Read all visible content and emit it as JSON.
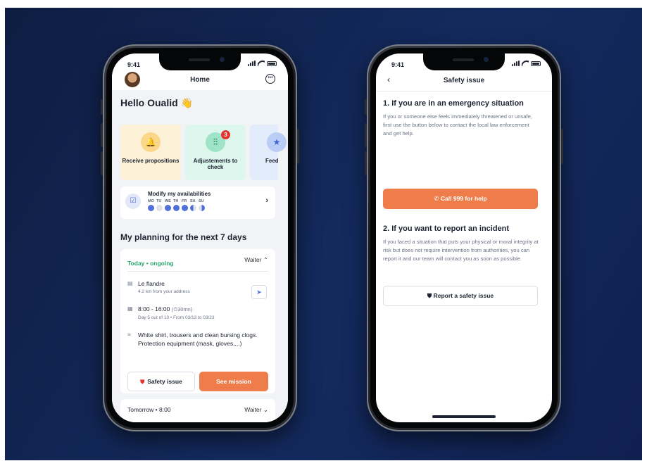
{
  "colors": {
    "background": "#0f2050",
    "accent": "#ef7d4b",
    "success": "#26a66b",
    "primary": "#4f6fd6",
    "danger": "#e2352f"
  },
  "status": {
    "time": "9:41"
  },
  "home": {
    "title": "Home",
    "greeting": "Hello Oualid 👋",
    "cards": [
      {
        "label": "Receive propositions",
        "icon": "bell-icon",
        "color": "#fdf1d7"
      },
      {
        "label": "Adjustements to check",
        "icon": "sliders-icon",
        "badge": "3",
        "color": "#def7ee"
      },
      {
        "label": "Feedb awaiti",
        "icon": "star-icon",
        "color": "#e3ecfb"
      }
    ],
    "availability": {
      "title": "Modify my availabilities",
      "days": [
        "MO",
        "TU",
        "WE",
        "TH",
        "FR",
        "SA",
        "SU"
      ]
    },
    "planning_title": "My planning for the next 7 days",
    "mission": {
      "status": "Today • ongoing",
      "role": "Waiter",
      "place": "Le flandre",
      "distance": "4.2 km from your address",
      "hours": "8:00 - 16:00",
      "break": "(⏱30mn)",
      "period": "Day 5 out of 10 • From 03/13 to 03/23",
      "dress_code": "White shirt, trousers and clean bursing clogs. Protection equipment (mask, gloves,...)",
      "safety_button": "Safety issue",
      "see_button": "See mission"
    },
    "next": {
      "when": "Tomorrow • 8:00",
      "role": "Waiter"
    }
  },
  "safety": {
    "title": "Safety issue",
    "section1_title": "1. If you are in an emergency situation",
    "section1_text": "If you or someone else feels immediately threatened or unsafe, first use the button below to contact the local law enforcement and get help.",
    "call_button": "Call 999 for help",
    "section2_title": "2. If you want to report an incident",
    "section2_text": "If you faced a situation that puts your physical or moral integrity at risk but does not require intervention from authorities, you can report it and our team will contact you as soon as possible.",
    "report_button": "Report a safety issue"
  }
}
